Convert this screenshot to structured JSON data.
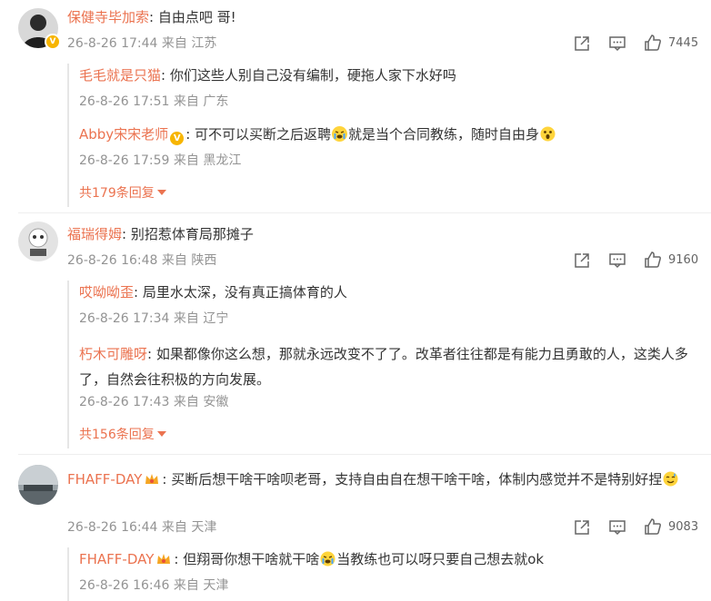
{
  "comments": [
    {
      "user": "保健寺毕加索",
      "text": ": 自由点吧 哥!",
      "time": "26-8-26 17:44",
      "location": "来自 江苏",
      "likes": "7445",
      "replies": [
        {
          "user": "毛毛就是只猫",
          "text": ": 你们这些人别自己没有编制，硬拖人家下水好吗",
          "time": "26-8-26 17:51",
          "location": "来自 广东"
        },
        {
          "user": "Abby宋宋老师",
          "text_a": ": 可不可以买断之后返聘",
          "text_b": "就是当个合同教练，随时自由身",
          "time": "26-8-26 17:59",
          "location": "来自 黑龙江"
        }
      ],
      "more": "共179条回复"
    },
    {
      "user": "福瑞得姆",
      "text": ": 别招惹体育局那摊子",
      "time": "26-8-26 16:48",
      "location": "来自 陕西",
      "likes": "9160",
      "replies": [
        {
          "user": "哎呦呦歪",
          "text": ": 局里水太深，没有真正搞体育的人",
          "time": "26-8-26 17:34",
          "location": "来自 辽宁"
        },
        {
          "user": "朽木可雕呀",
          "text": ": 如果都像你这么想，那就永远改变不了了。改革者往往都是有能力且勇敢的人，这类人多了，自然会往积极的方向发展。",
          "time": "26-8-26 17:43",
          "location": "来自 安徽"
        }
      ],
      "more": "共156条回复"
    },
    {
      "user": "FHAFF-DAY",
      "text": ": 买断后想干啥干啥呗老哥，支持自由自在想干啥干啥，体制内感觉并不是特别好捏",
      "time": "26-8-26 16:44",
      "location": "来自 天津",
      "likes": "9083",
      "replies": [
        {
          "user": "FHAFF-DAY",
          "text_a": ": 但翔哥你想干啥就干啥",
          "text_b": "当教练也可以呀只要自己想去就ok",
          "time": "26-8-26 16:46",
          "location": "来自 天津"
        }
      ]
    }
  ],
  "icons": {
    "share": "share-icon",
    "comment": "comment-icon",
    "like": "like-icon",
    "verified": "verified-badge-icon",
    "crown": "crown-badge-icon"
  },
  "colors": {
    "username": "#eb7350",
    "meta": "#939393",
    "verified": "#f7b500"
  }
}
